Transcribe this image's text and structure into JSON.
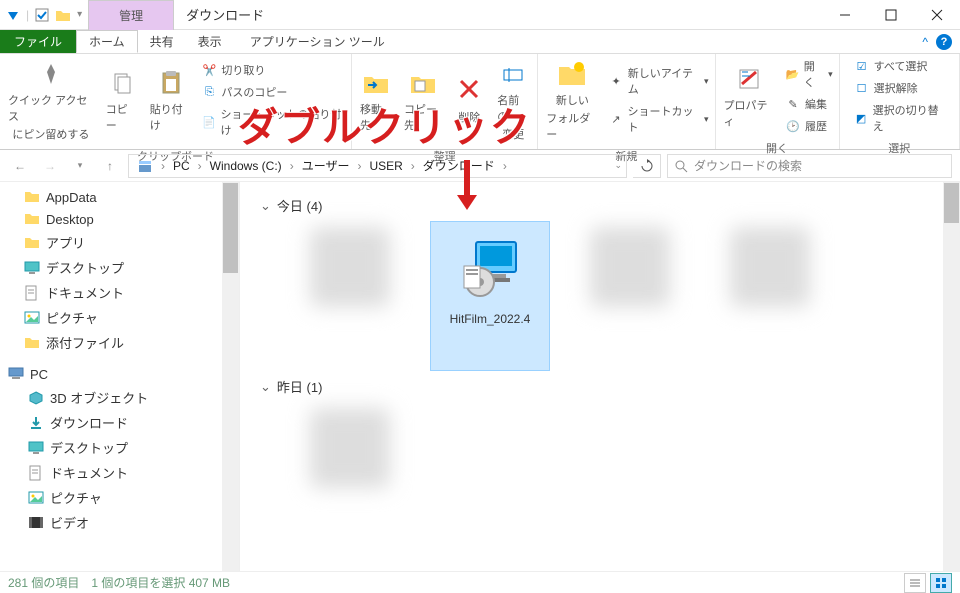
{
  "window": {
    "title": "ダウンロード",
    "manage_tab": "管理"
  },
  "tabs": {
    "file": "ファイル",
    "home": "ホーム",
    "share": "共有",
    "view": "表示",
    "apptools": "アプリケーション ツール"
  },
  "ribbon": {
    "pin": {
      "label1": "クイック アクセス",
      "label2": "にピン留めする"
    },
    "copy": "コピー",
    "paste": "貼り付け",
    "cut": "切り取り",
    "copypath": "パスのコピー",
    "pasteshortcut": "ショートカットの貼り付け",
    "clipboard_label": "クリップボード",
    "moveto1": "移動先",
    "moveto2": "コピー先",
    "delete": "削除",
    "rename1": "名前の",
    "rename2": "変更",
    "organize_label": "整理",
    "newfolder1": "新しい",
    "newfolder2": "フォルダー",
    "newitem": "新しいアイテム",
    "shortcut": "ショートカット",
    "new_label": "新規",
    "properties": "プロパティ",
    "open": "開く",
    "edit": "編集",
    "history": "履歴",
    "open_label": "開く",
    "selectall": "すべて選択",
    "selectnone": "選択解除",
    "invert": "選択の切り替え",
    "select_label": "選択"
  },
  "breadcrumb": {
    "items": [
      "PC",
      "Windows (C:)",
      "ユーザー",
      "USER",
      "ダウンロード"
    ]
  },
  "search": {
    "placeholder": "ダウンロードの検索"
  },
  "sidebar": {
    "items": [
      {
        "label": "AppData",
        "type": "folder"
      },
      {
        "label": "Desktop",
        "type": "folder"
      },
      {
        "label": "アプリ",
        "type": "folder"
      },
      {
        "label": "デスクトップ",
        "type": "desktop"
      },
      {
        "label": "ドキュメント",
        "type": "documents"
      },
      {
        "label": "ピクチャ",
        "type": "pictures"
      },
      {
        "label": "添付ファイル",
        "type": "folder"
      },
      {
        "label": "PC",
        "type": "pc"
      },
      {
        "label": "3D オブジェクト",
        "type": "3d"
      },
      {
        "label": "ダウンロード",
        "type": "downloads"
      },
      {
        "label": "デスクトップ",
        "type": "desktop"
      },
      {
        "label": "ドキュメント",
        "type": "documents"
      },
      {
        "label": "ピクチャ",
        "type": "pictures"
      },
      {
        "label": "ビデオ",
        "type": "video"
      }
    ]
  },
  "content": {
    "groups": [
      {
        "header": "今日 (4)",
        "files": [
          {
            "name": "",
            "blurred": true
          },
          {
            "name": "HitFilm_2022.4",
            "selected": true,
            "highlight": true,
            "icon": "installer"
          },
          {
            "name": "",
            "blurred": true
          },
          {
            "name": "",
            "blurred": true
          }
        ]
      },
      {
        "header": "昨日 (1)",
        "files": [
          {
            "name": "",
            "blurred": true
          }
        ]
      }
    ]
  },
  "statusbar": {
    "items": "281 個の項目",
    "selected": "1 個の項目を選択 407 MB"
  },
  "annotation": {
    "text": "ダブルクリック"
  }
}
